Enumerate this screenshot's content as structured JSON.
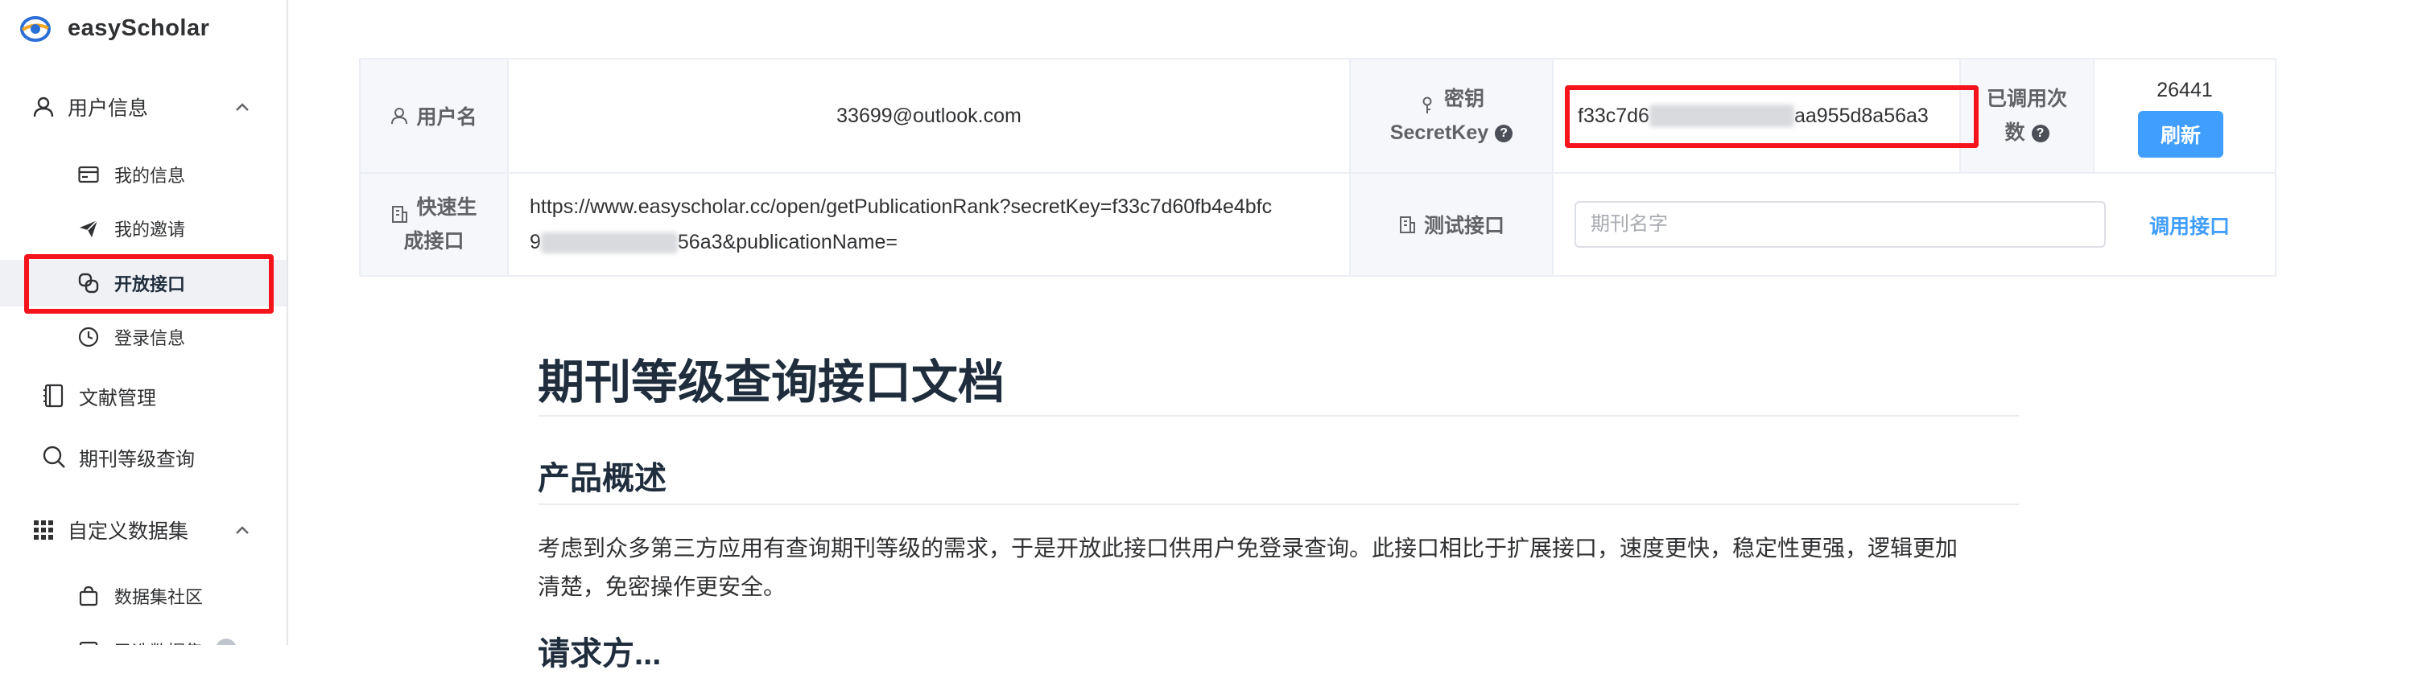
{
  "app": {
    "name": "easyScholar"
  },
  "sidebar": {
    "group_user": "用户信息",
    "items_user": [
      "我的信息",
      "我的邀请",
      "开放接口",
      "登录信息"
    ],
    "literature": "文献管理",
    "journal_query": "期刊等级查询",
    "group_dataset": "自定义数据集",
    "items_dataset": [
      "数据集社区",
      "已选数据集"
    ],
    "active_item": "开放接口"
  },
  "info": {
    "username_label": "用户名",
    "username_value": "33699@outlook.com",
    "secret_label_1": "密钥",
    "secret_label_2": "SecretKey",
    "secret_visible_start": "f33c7d6",
    "secret_visible_end": "aa955d8a56a3",
    "calls_label_1": "已调用次",
    "calls_label_2": "数",
    "calls_count": "26441",
    "refresh_label": "刷新",
    "quick_label_1": "快速生",
    "quick_label_2": "成接口",
    "quick_url_line1": "https://www.easyscholar.cc/open/getPublicationRank?secretKey=f33c7d60fb4e4bfc",
    "quick_url_line2_start": "9",
    "quick_url_line2_end": "56a3&publicationName=",
    "test_label": "测试接口",
    "test_placeholder": "期刊名字",
    "call_api_label": "调用接口"
  },
  "doc": {
    "title": "期刊等级查询接口文档",
    "section1": "产品概述",
    "paragraph1_line1": "考虑到众多第三方应用有查询期刊等级的需求，于是开放此接口供用户免登录查询。此接口相比于扩展接口，速度更快，稳定性更强，逻辑更加",
    "paragraph1_line2": "清楚，免密操作更安全。",
    "section2_partial": "请求方..."
  },
  "colors": {
    "highlight_red": "#f5131c",
    "primary_blue": "#409eff",
    "active_bg": "#eff1f5"
  }
}
